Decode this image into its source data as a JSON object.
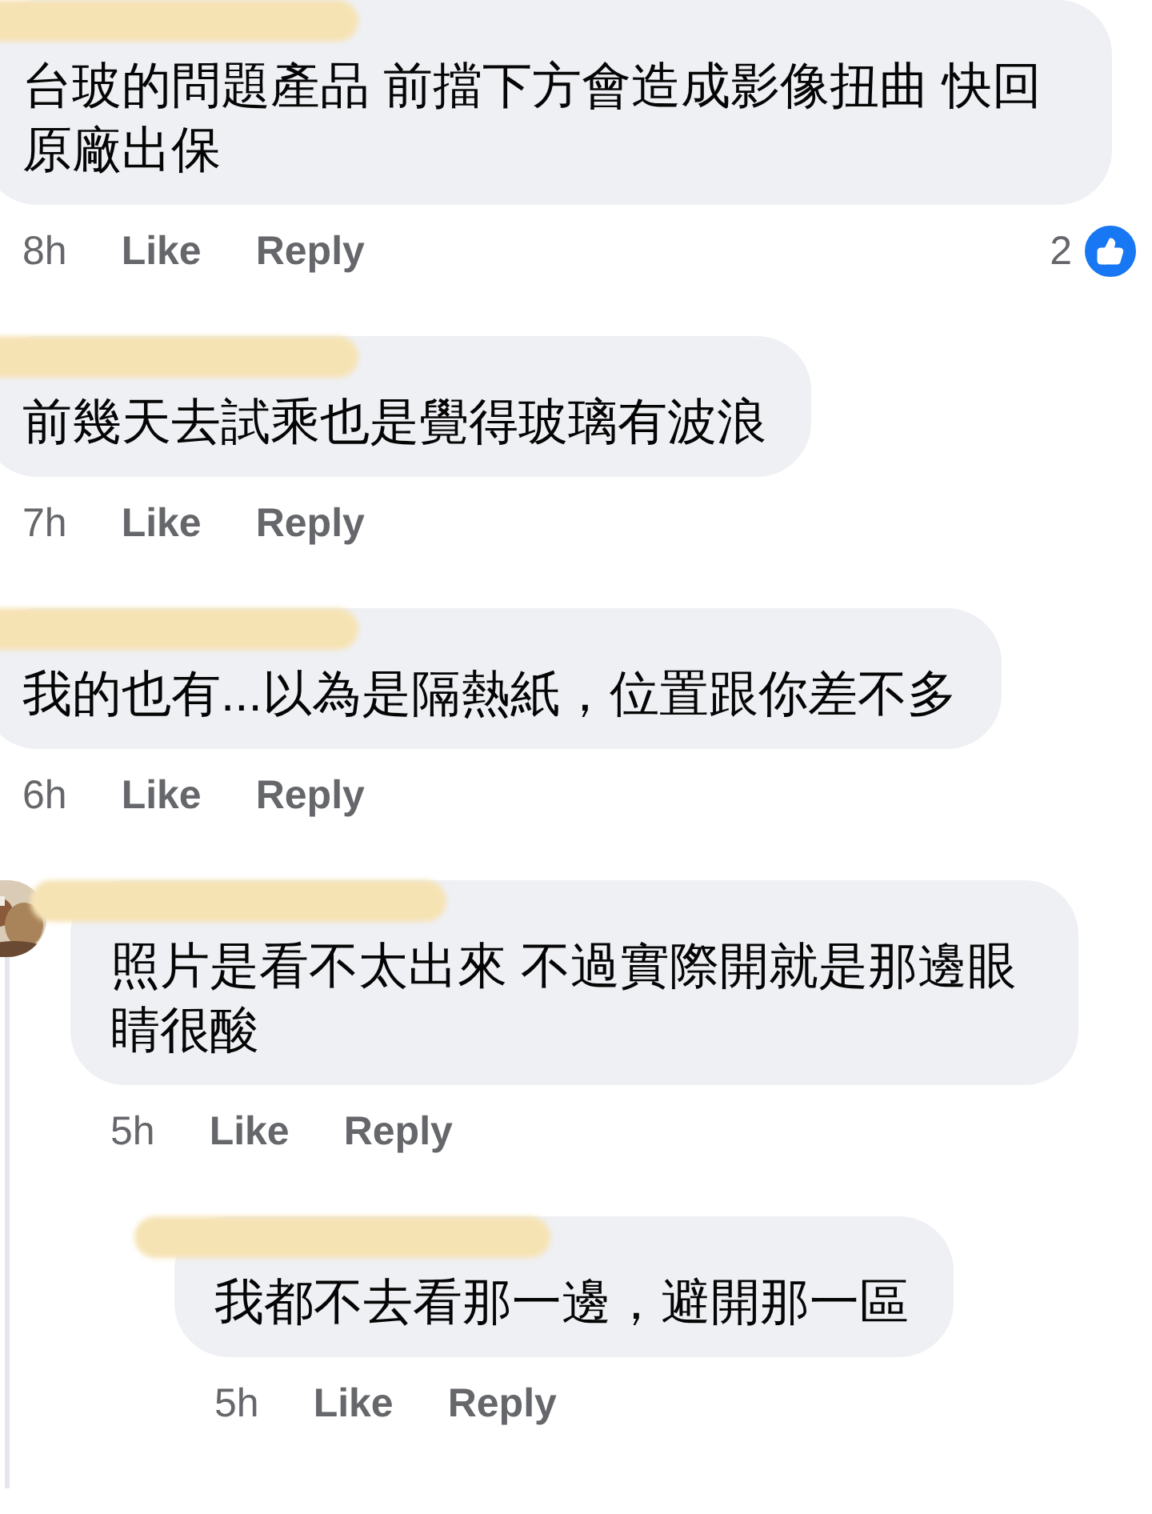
{
  "comments": [
    {
      "name_redacted": true,
      "text": "台玻的問題產品 前擋下方會造成影像扭曲 快回原廠出保",
      "time": "8h",
      "like": "Like",
      "reply": "Reply",
      "reactions": "2"
    },
    {
      "name_redacted": true,
      "text": "前幾天去試乘也是覺得玻璃有波浪",
      "time": "7h",
      "like": "Like",
      "reply": "Reply"
    },
    {
      "name_redacted": true,
      "text": "我的也有...以為是隔熱紙，位置跟你差不多",
      "time": "6h",
      "like": "Like",
      "reply": "Reply",
      "children": [
        {
          "name_redacted": true,
          "text": "照片是看不太出來 不過實際開就是那邊眼睛很酸",
          "time": "5h",
          "like": "Like",
          "reply": "Reply",
          "children": [
            {
              "name_redacted": true,
              "text": "我都不去看那一邊，避開那一區",
              "time": "5h",
              "like": "Like",
              "reply": "Reply"
            }
          ]
        }
      ]
    }
  ]
}
